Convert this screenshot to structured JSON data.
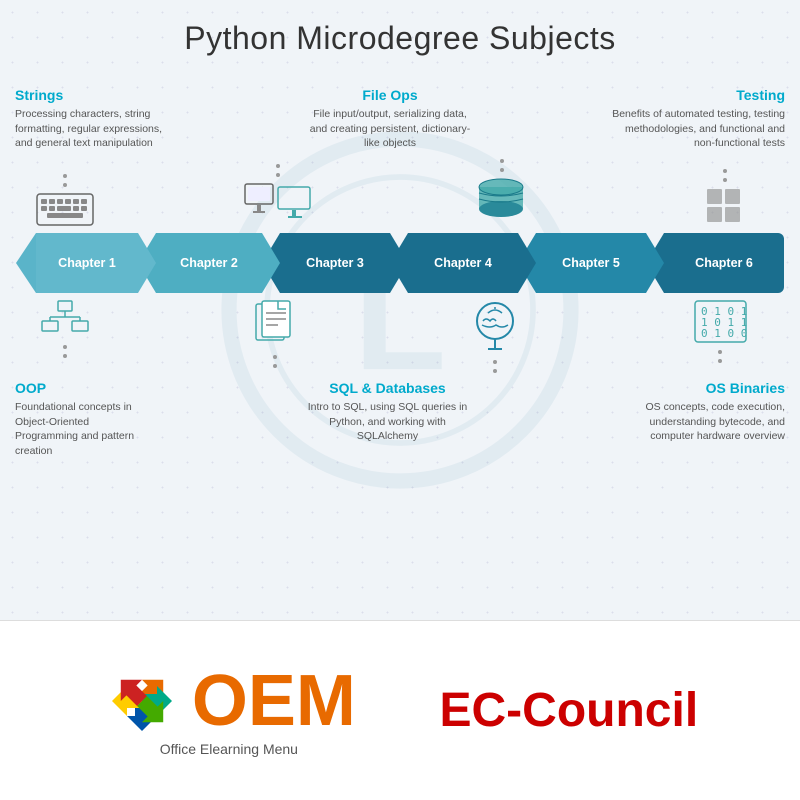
{
  "page": {
    "title": "Python Microdegree Subjects"
  },
  "chapters": [
    {
      "id": "ch1",
      "label": "Chapter 1"
    },
    {
      "id": "ch2",
      "label": "Chapter 2"
    },
    {
      "id": "ch3",
      "label": "Chapter 3"
    },
    {
      "id": "ch4",
      "label": "Chapter 4"
    },
    {
      "id": "ch5",
      "label": "Chapter 5"
    },
    {
      "id": "ch6",
      "label": "Chapter 6"
    }
  ],
  "top_topics": [
    {
      "id": "strings",
      "title": "Strings",
      "description": "Processing characters, string formatting, regular expressions, and general text manipulation"
    },
    {
      "id": "fileops",
      "title": "File Ops",
      "description": "File input/output, serializing data, and creating persistent, dictionary-like objects"
    },
    {
      "id": "testing",
      "title": "Testing",
      "description": "Benefits of automated testing, testing methodologies, and functional and non-functional tests"
    }
  ],
  "bottom_topics": [
    {
      "id": "oop",
      "title": "OOP",
      "description": "Foundational concepts in Object-Oriented Programming and pattern creation"
    },
    {
      "id": "sql",
      "title": "SQL & Databases",
      "description": "Intro to SQL, using SQL queries in Python, and working with SQLAlchemy"
    },
    {
      "id": "os_binaries",
      "title": "OS Binaries",
      "description": "OS concepts, code execution, understanding bytecode, and computer hardware overview"
    }
  ],
  "oem_logo": {
    "name": "OEM",
    "subtitle": "Office Elearning Menu"
  },
  "ec_council": {
    "name": "EC-Council"
  }
}
